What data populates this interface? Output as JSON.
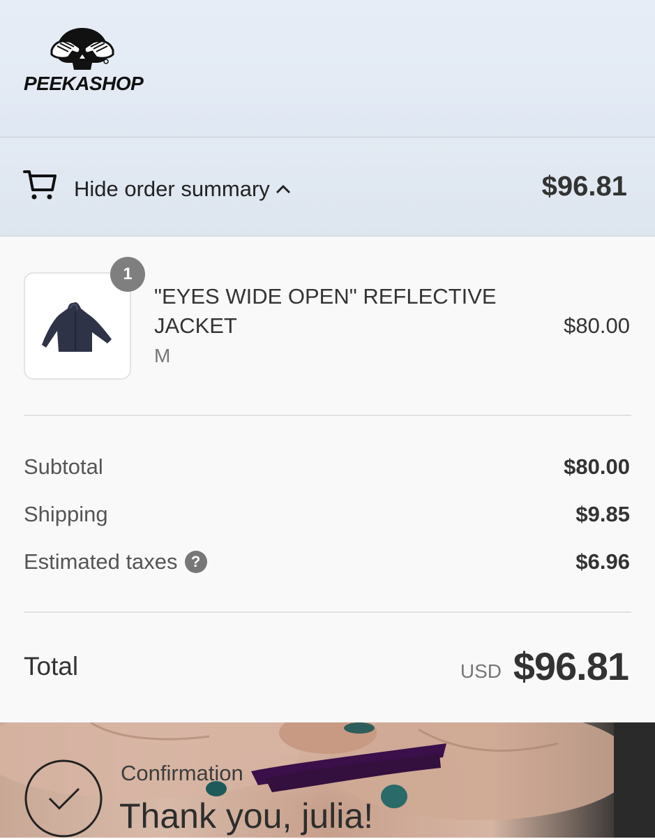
{
  "brand": {
    "name": "PEEKASHOP",
    "logo_icon": "hands-over-eyes-skull-icon"
  },
  "summary_bar": {
    "toggle_label": "Hide order summary",
    "total": "$96.81",
    "cart_icon": "cart-icon",
    "chevron_icon": "chevron-up-icon"
  },
  "line_items": [
    {
      "quantity": "1",
      "name": "\"EYES WIDE OPEN\" REFLECTIVE JACKET",
      "variant": "M",
      "price": "$80.00",
      "thumbnail_icon": "jacket-image"
    }
  ],
  "totals": {
    "subtotal_label": "Subtotal",
    "subtotal_value": "$80.00",
    "shipping_label": "Shipping",
    "shipping_value": "$9.85",
    "taxes_label": "Estimated taxes",
    "taxes_help": "?",
    "taxes_value": "$6.96",
    "total_label": "Total",
    "currency": "USD",
    "total_value": "$96.81"
  },
  "confirmation": {
    "label": "Confirmation",
    "thanks": "Thank you, julia!",
    "check_icon": "check-circle-icon"
  },
  "colors": {
    "header_bg": "#e4ebf5",
    "summary_bg": "#f9f9f9",
    "badge": "#7f7f7f",
    "text": "#333333",
    "redaction": "#3b0f4a"
  }
}
